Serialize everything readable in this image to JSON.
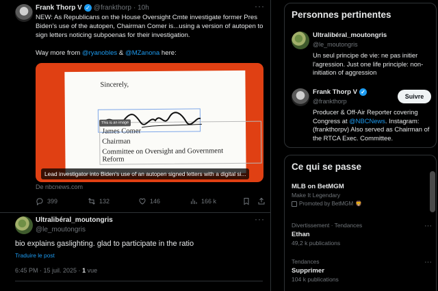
{
  "main_tweet": {
    "name": "Frank Thorp V",
    "handle": "@frankthorp",
    "time": "· 10h",
    "paragraph1": "NEW: As Republicans on the House Oversight Cmte investigate former Pres Biden's use of the autopen, Chairman Comer is...using a version of autopen to sign letters noticing subpoenas for their investigation.",
    "paragraph2_prefix": "Way more from ",
    "mention1": "@ryanobles",
    "amp": " & ",
    "mention2": "@MZanona",
    "paragraph2_suffix": " here:",
    "media": {
      "sincerely": "Sincerely,",
      "signature": "James Comer",
      "printed_name": "James Comer",
      "title": "Chairman",
      "committee": "Committee on Oversight and Government Reform",
      "alt_badge": "This is an image",
      "caption": "Lead investigator into Biden's use of an autopen signed letters with a digital si..."
    },
    "source": "De nbcnews.com",
    "actions": {
      "replies": "399",
      "reposts": "132",
      "likes": "146",
      "views": "166 k"
    }
  },
  "reply": {
    "name": "Ultralibéral_moutongris",
    "handle": "@le_moutongris",
    "body": "bio explains gaslighting. glad to participate in the ratio",
    "translate": "Traduire le post",
    "time": "6:45 PM · 15 juil. 2025 · ",
    "views_count": "1",
    "views_label": " vue"
  },
  "sidebar": {
    "people_title": "Personnes pertinentes",
    "people": [
      {
        "name": "Ultralibéral_moutongris",
        "handle": "@le_moutongris",
        "bio": "Un seul principe de vie: ne pas initier l'agression. Just one life principle: non-initiation of aggression"
      },
      {
        "name": "Frank Thorp V",
        "handle": "@frankthorp",
        "bio_prefix": "Producer & Off-Air Reporter covering Congress at ",
        "bio_link": "@NBCNews",
        "bio_suffix": ". Instagram: (frankthorpv) Also served as Chairman of the RTCA Exec. Committee.",
        "follow_label": "Suivre"
      }
    ],
    "trends_title": "Ce qui se passe",
    "trends": [
      {
        "name": "MLB on BetMGM",
        "sub": "Make It Legendary",
        "promo": "Promoted by BetMGM"
      },
      {
        "category": "Divertissement · Tendances",
        "name": "Ethan",
        "sub": "49,2 k publications"
      },
      {
        "category": "Tendances",
        "name": "Supprimer",
        "sub": "104 k publications"
      }
    ]
  },
  "colors": {
    "accent": "#1d9bf0",
    "media_bg": "#e04013"
  }
}
